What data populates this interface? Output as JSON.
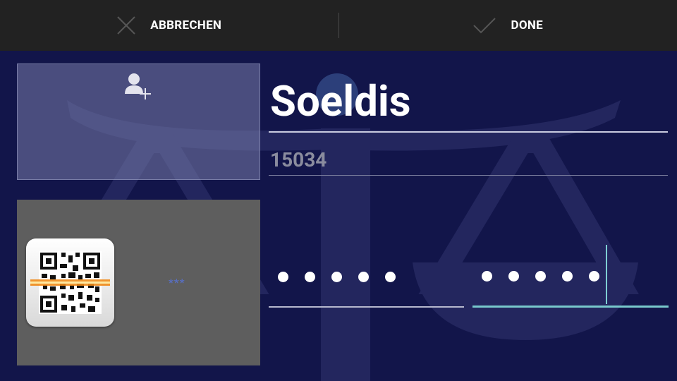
{
  "actionbar": {
    "cancel_label": "ABBRECHEN",
    "cancel_icon": "close-icon",
    "done_label": "DONE",
    "done_icon": "check-icon"
  },
  "photo": {
    "icon": "add-contact-icon"
  },
  "qr": {
    "icon": "qr-scanner-icon",
    "masked_text": "***"
  },
  "form": {
    "name": "Soeldis",
    "number": "15034",
    "pin_1_length": 5,
    "pin_2_length": 5
  },
  "colors": {
    "background": "#12154a",
    "actionbar": "#222222",
    "focus_accent": "#78c8cc"
  }
}
